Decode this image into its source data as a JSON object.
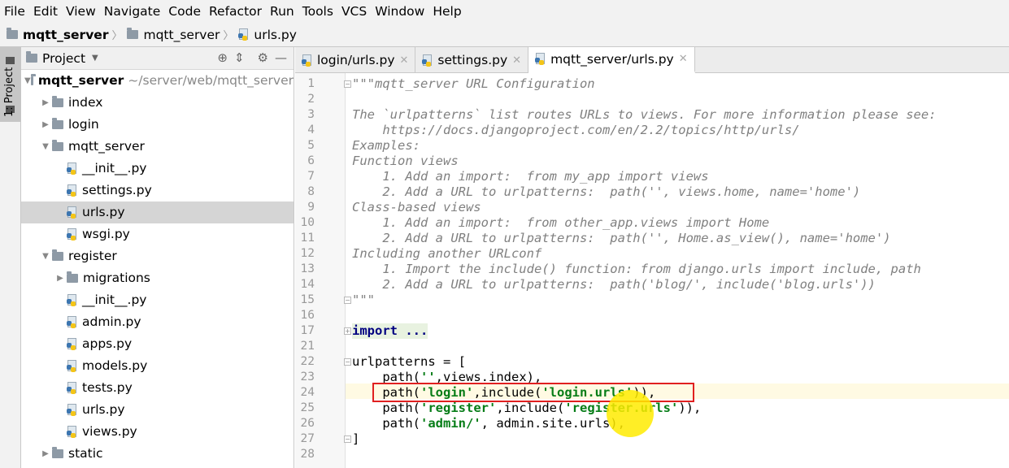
{
  "menu": [
    "File",
    "Edit",
    "View",
    "Navigate",
    "Code",
    "Refactor",
    "Run",
    "Tools",
    "VCS",
    "Window",
    "Help"
  ],
  "breadcrumb": [
    "mqtt_server",
    "mqtt_server",
    "urls.py"
  ],
  "side_tab": "1: Project",
  "project": {
    "title": "Project",
    "root": {
      "name": "mqtt_server",
      "path": "~/server/web/mqtt_server"
    },
    "items": [
      {
        "label": "index",
        "type": "folder",
        "level": 1,
        "expanded": false
      },
      {
        "label": "login",
        "type": "folder",
        "level": 1,
        "expanded": false
      },
      {
        "label": "mqtt_server",
        "type": "folder",
        "level": 1,
        "expanded": true
      },
      {
        "label": "__init__.py",
        "type": "py",
        "level": 2
      },
      {
        "label": "settings.py",
        "type": "py",
        "level": 2
      },
      {
        "label": "urls.py",
        "type": "py",
        "level": 2,
        "selected": true
      },
      {
        "label": "wsgi.py",
        "type": "py",
        "level": 2
      },
      {
        "label": "register",
        "type": "folder",
        "level": 1,
        "expanded": true
      },
      {
        "label": "migrations",
        "type": "folder",
        "level": 2,
        "expanded": false
      },
      {
        "label": "__init__.py",
        "type": "py",
        "level": 2
      },
      {
        "label": "admin.py",
        "type": "py",
        "level": 2
      },
      {
        "label": "apps.py",
        "type": "py",
        "level": 2
      },
      {
        "label": "models.py",
        "type": "py",
        "level": 2
      },
      {
        "label": "tests.py",
        "type": "py",
        "level": 2
      },
      {
        "label": "urls.py",
        "type": "py",
        "level": 2
      },
      {
        "label": "views.py",
        "type": "py",
        "level": 2
      },
      {
        "label": "static",
        "type": "folder",
        "level": 1,
        "expanded": false
      }
    ]
  },
  "tabs": [
    {
      "label": "login/urls.py",
      "active": false
    },
    {
      "label": "settings.py",
      "active": false
    },
    {
      "label": "mqtt_server/urls.py",
      "active": true
    }
  ],
  "line_numbers": [
    "1",
    "2",
    "3",
    "4",
    "5",
    "6",
    "7",
    "8",
    "9",
    "10",
    "11",
    "12",
    "13",
    "14",
    "15",
    "16",
    "17",
    "21",
    "22",
    "23",
    "24",
    "25",
    "26",
    "27",
    "28"
  ],
  "code_lines": [
    "\"\"\"mqtt_server URL Configuration",
    "",
    "The `urlpatterns` list routes URLs to views. For more information please see:",
    "    https://docs.djangoproject.com/en/2.2/topics/http/urls/",
    "Examples:",
    "Function views",
    "    1. Add an import:  from my_app import views",
    "    2. Add a URL to urlpatterns:  path('', views.home, name='home')",
    "Class-based views",
    "    1. Add an import:  from other_app.views import Home",
    "    2. Add a URL to urlpatterns:  path('', Home.as_view(), name='home')",
    "Including another URLconf",
    "    1. Import the include() function: from django.urls import include, path",
    "    2. Add a URL to urlpatterns:  path('blog/', include('blog.urls'))",
    "\"\"\"",
    "",
    "import ...",
    "",
    "urlpatterns = [",
    "    path('',views.index),",
    "    path('login',include('login.urls')),",
    "    path('register',include('register.urls')),",
    "    path('admin/', admin.site.urls),",
    "]",
    ""
  ],
  "colors": {
    "selection": "#d5d5d5",
    "highlight_box": "#e02020",
    "cursor_spot": "#ffeb00",
    "string": "#067d17",
    "comment": "#808080"
  }
}
